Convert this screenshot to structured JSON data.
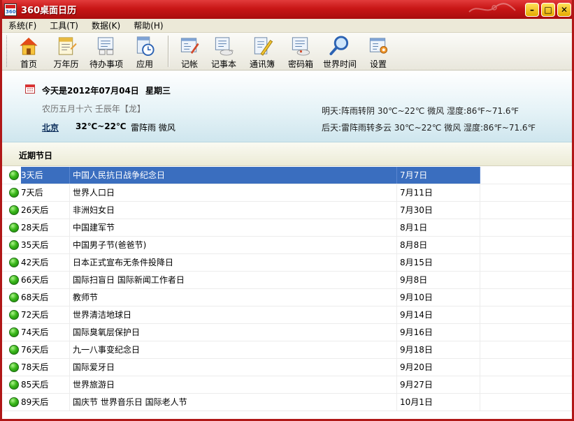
{
  "window": {
    "title": "360桌面日历"
  },
  "menu": [
    "系统(F)",
    "工具(T)",
    "数据(K)",
    "帮助(H)"
  ],
  "toolbar": {
    "group1": [
      {
        "label": "首页",
        "icon": "home-icon"
      },
      {
        "label": "万年历",
        "icon": "calendar-book-icon"
      },
      {
        "label": "待办事项",
        "icon": "todo-icon"
      },
      {
        "label": "应用",
        "icon": "apps-clock-icon"
      }
    ],
    "group2": [
      {
        "label": "记帐",
        "icon": "ledger-icon"
      },
      {
        "label": "记事本",
        "icon": "notepad-icon"
      },
      {
        "label": "通讯簿",
        "icon": "addressbook-icon"
      },
      {
        "label": "密码箱",
        "icon": "password-box-icon"
      },
      {
        "label": "世界时间",
        "icon": "magnifier-icon"
      },
      {
        "label": "设置",
        "icon": "settings-icon"
      }
    ]
  },
  "today": {
    "date": "今天是2012年07月04日",
    "weekday": "星期三",
    "lunar": "农历五月十六 壬辰年【龙】",
    "city": "北京",
    "temp": "32℃~22℃",
    "condition": "雷阵雨 微风",
    "tomorrow": "明天:阵雨转阴 30℃~22℃ 微风 湿度:86℉~71.6℉",
    "day_after": "后天:雷阵雨转多云 30℃~22℃ 微风 湿度:86℉~71.6℉"
  },
  "section_title": "近期节日",
  "holidays": [
    {
      "days": "3天后",
      "name": "中国人民抗日战争纪念日",
      "date": "7月7日",
      "selected": true
    },
    {
      "days": "7天后",
      "name": "世界人口日",
      "date": "7月11日"
    },
    {
      "days": "26天后",
      "name": "非洲妇女日",
      "date": "7月30日"
    },
    {
      "days": "28天后",
      "name": "中国建军节",
      "date": "8月1日"
    },
    {
      "days": "35天后",
      "name": "中国男子节(爸爸节)",
      "date": "8月8日"
    },
    {
      "days": "42天后",
      "name": "日本正式宣布无条件投降日",
      "date": "8月15日"
    },
    {
      "days": "66天后",
      "name": "国际扫盲日 国际新闻工作者日",
      "date": "9月8日"
    },
    {
      "days": "68天后",
      "name": "教师节",
      "date": "9月10日"
    },
    {
      "days": "72天后",
      "name": "世界清洁地球日",
      "date": "9月14日"
    },
    {
      "days": "74天后",
      "name": "国际臭氧层保护日",
      "date": "9月16日"
    },
    {
      "days": "76天后",
      "name": "九一八事变纪念日",
      "date": "9月18日"
    },
    {
      "days": "78天后",
      "name": "国际爱牙日",
      "date": "9月20日"
    },
    {
      "days": "85天后",
      "name": "世界旅游日",
      "date": "9月27日"
    },
    {
      "days": "89天后",
      "name": "国庆节 世界音乐日 国际老人节",
      "date": "10月1日"
    }
  ]
}
